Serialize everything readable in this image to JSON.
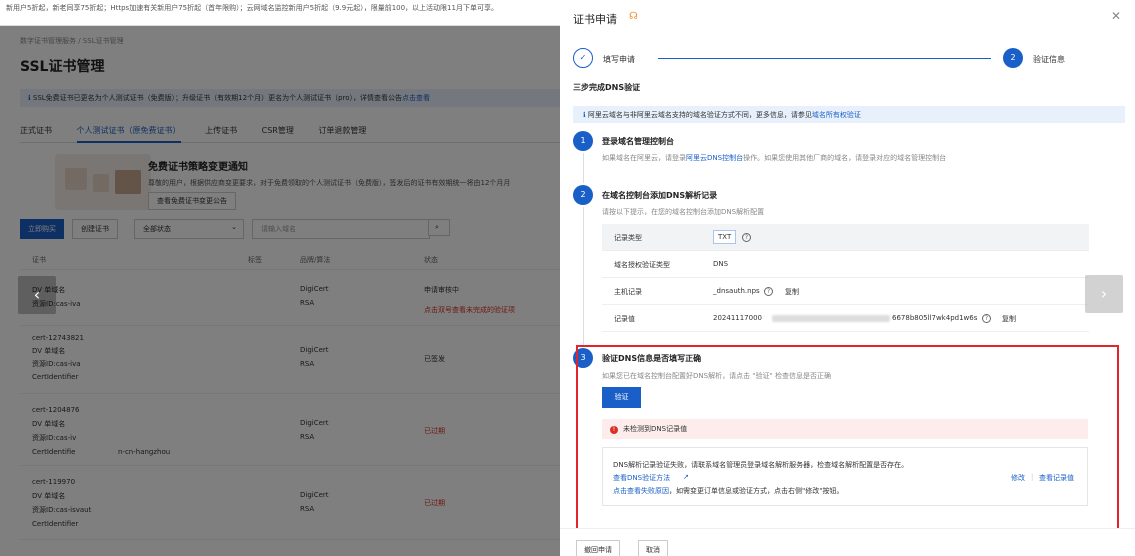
{
  "top_banner": "新用户5折起，新老同享75折起；Https加速有关新用户75折起（首年限购）；云网域名监控新用户5折起（9.9元起），限量前100，以上活动限11月下单可享。",
  "breadcrumb": "数字证书管理服务 / SSL证书管理",
  "page_title": "SSL证书管理",
  "notice": {
    "text": "SSL免费证书已更名为个人测试证书（免费版）；升级证书（有效期12个月）更名为个人测试证书（pro），详情查看公告",
    "link": "点击查看"
  },
  "tabs": [
    "正式证书",
    "个人测试证书（原免费证书）",
    "上传证书",
    "CSR管理",
    "订单退款管理"
  ],
  "policy": {
    "title": "免费证书策略变更通知",
    "desc": "尊敬的用户，根据供应商变更要求，对于免费领取的个人测试证书（免费版），签发后的证书有效期统一将由12个月月",
    "button": "查看免费证书变更公告"
  },
  "toolbar": {
    "buy": "立即购买",
    "create": "创建证书",
    "status": "全部状态",
    "search_placeholder": "请输入域名"
  },
  "table": {
    "headers": [
      "证书",
      "标签",
      "品牌/算法",
      "状态"
    ],
    "rows": [
      {
        "id": "",
        "type": "DV 单域名",
        "res": "资源ID:cas-iva",
        "brand": "DigiCert",
        "algo": "RSA",
        "status": "申请审核中",
        "status_sub": "点击双号查看未完成的验证项"
      },
      {
        "id": "cert-12743821",
        "type": "DV 单域名",
        "res": "资源ID:cas-iva",
        "cid": "CertIdentifier",
        "brand": "DigiCert",
        "algo": "RSA",
        "status": "已签发"
      },
      {
        "id": "cert-1204876",
        "type": "DV 单域名",
        "res": "资源ID:cas-iv",
        "cid": "CertIdentifie",
        "cid_tail": "n-cn-hangzhou",
        "brand": "DigiCert",
        "algo": "RSA",
        "status": "已过期"
      },
      {
        "id": "cert-119970",
        "type": "DV 单域名",
        "res": "资源ID:cas-isvaut",
        "cid": "CertIdentifier",
        "brand": "DigiCert",
        "algo": "RSA",
        "status": "已过期"
      }
    ]
  },
  "drawer": {
    "title": "证书申请",
    "step1": "填写申请",
    "step2_num": "2",
    "step2": "验证信息",
    "section_title": "三步完成DNS验证",
    "info": {
      "text": "阿里云域名与非阿里云域名支持的域名验证方式不同，更多信息，请参见",
      "link": "域名所有权验证"
    },
    "s1": {
      "num": "1",
      "title": "登录域名管理控制台",
      "desc_a": "如果域名在阿里云，请登录",
      "link": "阿里云DNS控制台",
      "desc_b": "操作。如果您使用其他厂商的域名，请登录对应的域名管理控制台"
    },
    "s2": {
      "num": "2",
      "title": "在域名控制台添加DNS解析记录",
      "desc": "请按以下提示，在您的域名控制台添加DNS解析配置"
    },
    "records": {
      "type_k": "记录类型",
      "type_v": "TXT",
      "auth_k": "域名授权验证类型",
      "auth_v": "DNS",
      "host_k": "主机记录",
      "host_v": "_dnsauth.nps",
      "host_copy": "复制",
      "val_k": "记录值",
      "val_a": "20241117000",
      "val_b": "6678b805ll7wk4pd1w6s",
      "val_copy": "复制"
    },
    "s3": {
      "num": "3",
      "title": "验证DNS信息是否填写正确",
      "desc": "如果您已在域名控制台配置好DNS解析，请点击 \"验证\" 检查信息是否正确",
      "button": "验证"
    },
    "error": {
      "title": "未检测到DNS记录值",
      "line1": "DNS解析记录验证失败，请联系域名管理员登录域名解析服务器，检查域名解析配置是否存在。",
      "link1": "查看DNS验证方法",
      "link2": "点击查看失败原因",
      "line2": "，如需变更订单信息或验证方式，点击右侧\"修改\"按钮。",
      "modify": "修改",
      "view": "查看记录值"
    },
    "footer": {
      "withdraw": "撤回申请",
      "cancel": "取消"
    }
  }
}
